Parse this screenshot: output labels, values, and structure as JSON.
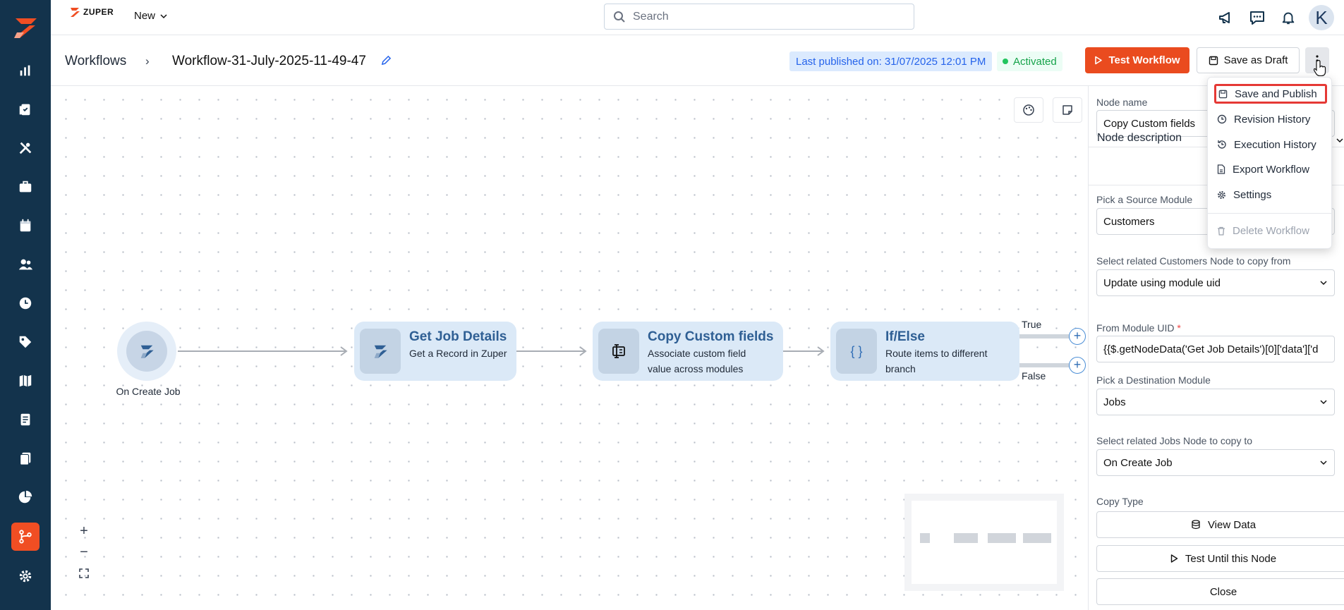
{
  "topbar": {
    "brand": "ZUPER",
    "new_label": "New",
    "search_placeholder": "Search",
    "avatar_initial": "K"
  },
  "header": {
    "breadcrumb_root": "Workflows",
    "breadcrumb_separator": "›",
    "workflow_title": "Workflow-31-July-2025-11-49-47",
    "last_published": "Last published on: 31/07/2025 12:01 PM",
    "status": "Activated",
    "test_button": "Test Workflow",
    "draft_button": "Save as Draft"
  },
  "menu": {
    "items": [
      {
        "label": "Save and Publish",
        "icon": "save-icon"
      },
      {
        "label": "Revision History",
        "icon": "clock-icon"
      },
      {
        "label": "Execution History",
        "icon": "history-icon"
      },
      {
        "label": "Export Workflow",
        "icon": "file-export-icon"
      },
      {
        "label": "Settings",
        "icon": "gear-icon"
      }
    ],
    "delete_label": "Delete Workflow"
  },
  "canvas": {
    "trigger_label": "On Create Job",
    "nodes": [
      {
        "title": "Get Job Details",
        "sub1": "Get a Record in Zuper",
        "sub2": ""
      },
      {
        "title": "Copy Custom fields",
        "sub1": "Associate custom field",
        "sub2": "value across modules"
      },
      {
        "title": "If/Else",
        "sub1": "Route items to different",
        "sub2": "branch"
      }
    ],
    "branch_true": "True",
    "branch_false": "False",
    "zoom_in": "+",
    "zoom_out": "−"
  },
  "panel": {
    "node_name_label": "Node name",
    "node_name_value": "Copy Custom fields",
    "node_description_label": "Node description",
    "source_module_label": "Pick a Source Module",
    "source_module_value": "Customers",
    "related_source_label": "Select related Customers Node to copy from",
    "related_source_value": "Update using module uid",
    "from_uid_label": "From Module UID",
    "from_uid_required": "*",
    "from_uid_value": "{{$.getNodeData('Get Job Details')[0]['data']['d",
    "dest_module_label": "Pick a Destination Module",
    "dest_module_value": "Jobs",
    "related_dest_label": "Select related Jobs Node to copy to",
    "related_dest_value": "On Create Job",
    "copy_type_label": "Copy Type",
    "view_data_button": "View Data",
    "test_until_button": "Test Until this Node",
    "close_button": "Close"
  },
  "colors": {
    "rail": "#13334c",
    "accent": "#ea4b1f",
    "node_bg": "#dbe9f7",
    "node_title": "#2f5f94"
  }
}
